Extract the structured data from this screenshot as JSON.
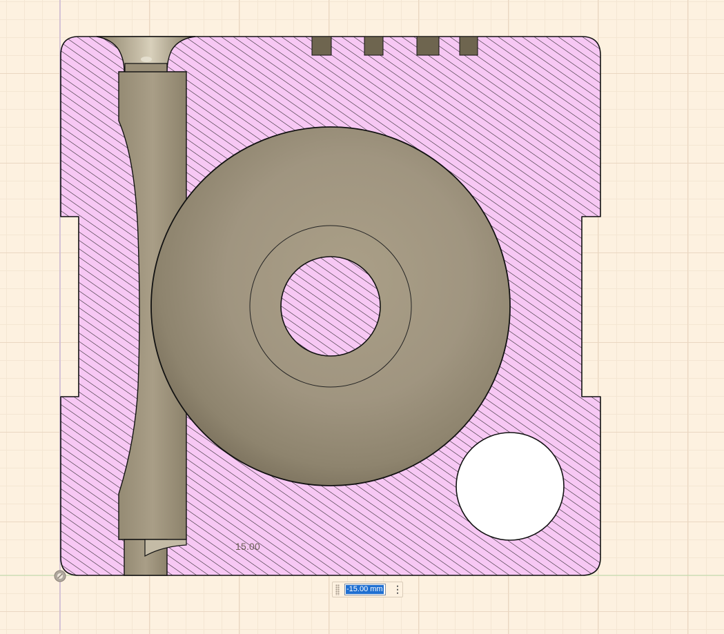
{
  "viewport": {
    "background": "#fdf1e0",
    "section_fill": "#f7c8f4",
    "hatch_color": "#1c1c1c",
    "body_color": "#a39880"
  },
  "dimension": {
    "label": "15.00",
    "input_value": "-15.00 mm",
    "menu_icon": "vertical-ellipsis-icon"
  },
  "origin_icon": "origin-pivot-icon"
}
